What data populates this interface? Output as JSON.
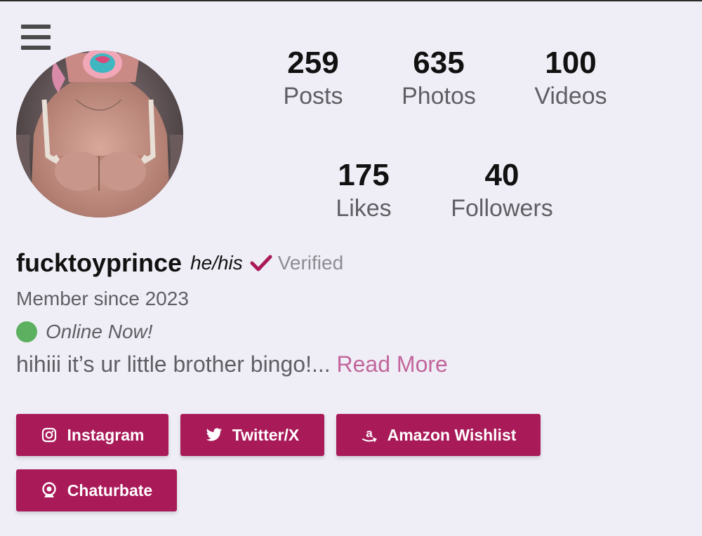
{
  "header": {
    "menu_icon": "hamburger-menu-icon"
  },
  "profile": {
    "avatar_icon": "profile-photo",
    "username": "fucktoyprince",
    "pronouns": "he/his",
    "verified_icon": "checkmark-icon",
    "verified_label": "Verified",
    "verified_color": "#a91a58",
    "member_since": "Member since 2023",
    "online_status": "Online Now!",
    "online_color": "#5cb060",
    "bio_text": "hihiii it’s ur little brother bingo!... ",
    "read_more": "Read More",
    "read_more_color": "#c2659c"
  },
  "stats": [
    {
      "value": "259",
      "label": "Posts"
    },
    {
      "value": "635",
      "label": "Photos"
    },
    {
      "value": "100",
      "label": "Videos"
    },
    {
      "value": "175",
      "label": "Likes"
    },
    {
      "value": "40",
      "label": "Followers"
    }
  ],
  "social_links": [
    {
      "label": "Instagram",
      "icon": "instagram-icon"
    },
    {
      "label": "Twitter/X",
      "icon": "twitter-icon"
    },
    {
      "label": "Amazon Wishlist",
      "icon": "amazon-icon"
    },
    {
      "label": "Chaturbate",
      "icon": "webcam-icon"
    }
  ],
  "colors": {
    "accent": "#a91a58",
    "background": "#efeef6"
  }
}
